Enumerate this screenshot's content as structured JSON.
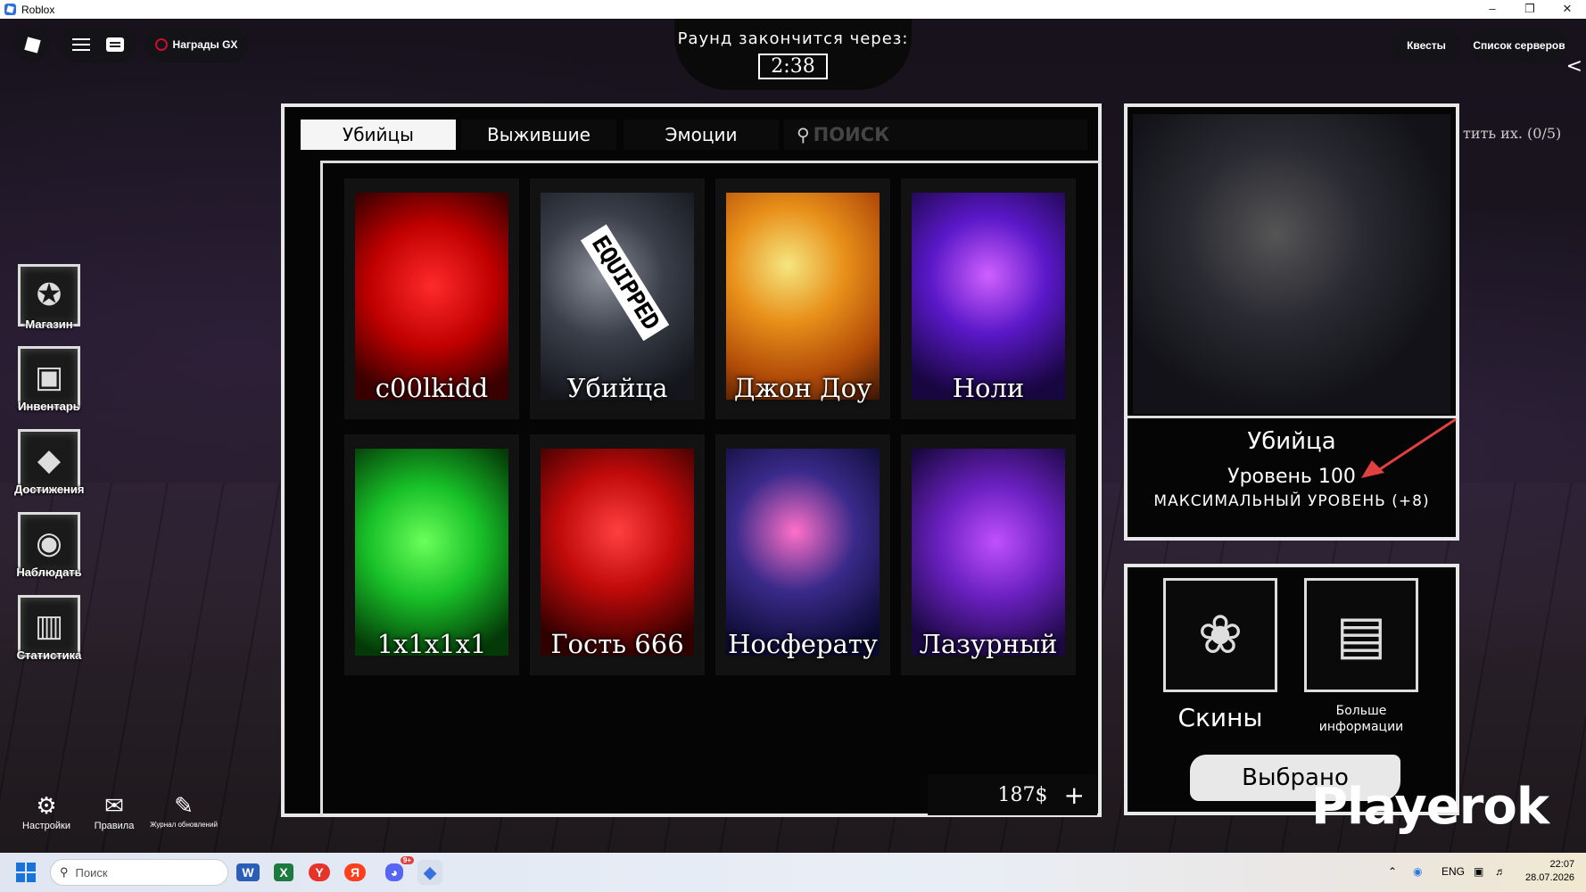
{
  "window": {
    "title": "Roblox",
    "controls": [
      "–",
      "❐",
      "✕"
    ]
  },
  "topbar": {
    "gx_label": "Награды GX",
    "quests_label": "Квесты",
    "servers_label": "Список серверов",
    "collapse_glyph": "<"
  },
  "timer": {
    "label": "Раунд закончится через:",
    "value": "2:38"
  },
  "side_menu": [
    {
      "label": "Магазин",
      "icon": "shop-icon",
      "glyph": "✪"
    },
    {
      "label": "Инвентарь",
      "icon": "inventory-icon",
      "glyph": "▣"
    },
    {
      "label": "Достижения",
      "icon": "achievements-icon",
      "glyph": "◆"
    },
    {
      "label": "Наблюдать",
      "icon": "spectate-eye-icon",
      "glyph": "◉"
    },
    {
      "label": "Статистика",
      "icon": "stats-icon",
      "glyph": "▥"
    }
  ],
  "bottom_buttons": [
    {
      "label": "Настройки",
      "icon": "gear-icon",
      "glyph": "⚙"
    },
    {
      "label": "Правила",
      "icon": "rules-scroll-icon",
      "glyph": "✉"
    },
    {
      "label": "Журнал обновлений",
      "icon": "changelog-icon",
      "glyph": "✎"
    }
  ],
  "tabs": [
    {
      "label": "Убийцы",
      "active": true
    },
    {
      "label": "Выжившие",
      "active": false
    },
    {
      "label": "Эмоции",
      "active": false
    }
  ],
  "search": {
    "placeholder": "ПОИСК"
  },
  "characters": [
    {
      "name": "c00lkidd",
      "color": "#d40000",
      "equipped": false
    },
    {
      "name": "Убийца",
      "color": "#3a3f4a",
      "equipped": true,
      "equipped_label": "EQUIPPED"
    },
    {
      "name": "Джон Доу",
      "color": "#e07a10",
      "equipped": false
    },
    {
      "name": "Ноли",
      "color": "#5a18c8",
      "equipped": false
    },
    {
      "name": "1x1x1x1",
      "color": "#18c028",
      "equipped": false
    },
    {
      "name": "Гость 666",
      "color": "#c00a0a",
      "equipped": false
    },
    {
      "name": "Носферату",
      "color": "#3a2a8a",
      "equipped": false
    },
    {
      "name": "Лазурный",
      "color": "#6a20c0",
      "equipped": false
    }
  ],
  "money": {
    "amount": "187$",
    "plus": "+"
  },
  "selected_character": {
    "name": "Убийца",
    "level": "Уровень 100",
    "max_level": "МАКСИМАЛЬНЫЙ УРОВЕНЬ (+8)"
  },
  "actions": {
    "skins_label": "Скины",
    "more_info_label": "Больше информации",
    "selected_label": "Выбрано"
  },
  "hint_text": "тить их. (0/5)",
  "watermark": "Playerok",
  "taskbar": {
    "search_placeholder": "Поиск",
    "lang": "ENG",
    "time": "22:07",
    "date": "28.07.2026",
    "apps": [
      {
        "icon": "word-icon",
        "glyph": "W",
        "color": "#2b5eb6"
      },
      {
        "icon": "excel-icon",
        "glyph": "X",
        "color": "#1d7a3e"
      },
      {
        "icon": "yandex-browser-icon",
        "glyph": "Y",
        "color": "#e8332b"
      },
      {
        "icon": "yandex-icon",
        "glyph": "Я",
        "color": "#fc3f1d"
      },
      {
        "icon": "discord-icon",
        "glyph": "◕",
        "color": "#5865f2"
      },
      {
        "icon": "roblox-icon",
        "glyph": "◆",
        "color": "#3a6fe0"
      }
    ],
    "discord_badge": "9+"
  },
  "colors": {
    "panel_bg": "#050505",
    "panel_border": "#e8e8e8",
    "arrow": "#e04040"
  }
}
